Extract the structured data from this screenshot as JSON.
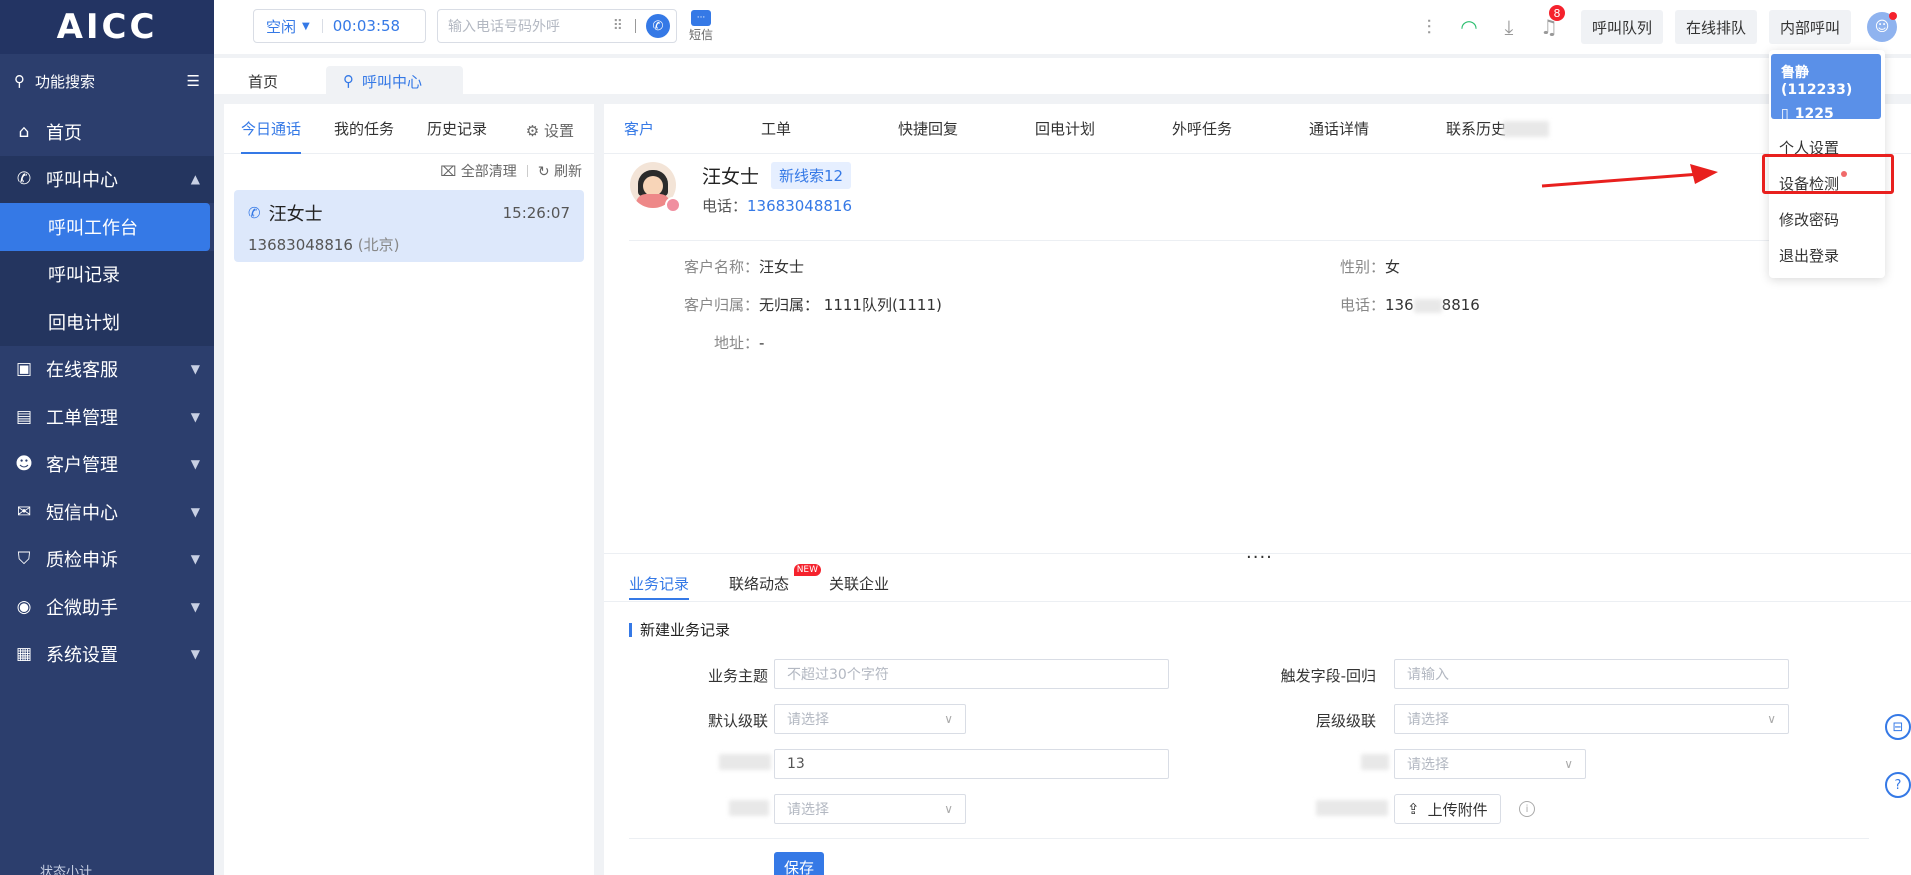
{
  "app": {
    "logo": "AICC"
  },
  "sidebar": {
    "search_label": "功能搜索",
    "items": [
      {
        "label": "首页",
        "icon": "home-icon"
      },
      {
        "label": "呼叫中心",
        "icon": "phone-icon",
        "open": true,
        "children": [
          {
            "label": "呼叫工作台",
            "active": true
          },
          {
            "label": "呼叫记录"
          },
          {
            "label": "回电计划"
          }
        ]
      },
      {
        "label": "在线客服",
        "icon": "chat-icon"
      },
      {
        "label": "工单管理",
        "icon": "clipboard-icon"
      },
      {
        "label": "客户管理",
        "icon": "users-icon"
      },
      {
        "label": "短信中心",
        "icon": "mail-icon"
      },
      {
        "label": "质检申诉",
        "icon": "shield-icon"
      },
      {
        "label": "企微助手",
        "icon": "wechat-icon"
      },
      {
        "label": "系统设置",
        "icon": "grid-icon"
      }
    ],
    "bottom_label": "状态小计"
  },
  "topbar": {
    "status": "空闲",
    "timer": "00:03:58",
    "dial_placeholder": "输入电话号码外呼",
    "sms_label": "短信",
    "notification_count": "8",
    "buttons": [
      "呼叫队列",
      "在线排队",
      "内部呼叫"
    ]
  },
  "page_tabs": [
    {
      "label": "首页"
    },
    {
      "label": "呼叫中心",
      "active": true
    }
  ],
  "call_panel": {
    "tabs": [
      "今日通话",
      "我的任务",
      "历史记录"
    ],
    "settings_label": "设置",
    "clear_all_label": "全部清理",
    "refresh_label": "刷新",
    "calls": [
      {
        "name": "汪女士",
        "time": "15:26:07",
        "number": "13683048816",
        "location": "(北京)"
      }
    ]
  },
  "main": {
    "tabs": [
      "客户",
      "工单",
      "快捷回复",
      "回电计划",
      "外呼任务",
      "通话详情",
      "联系历史"
    ],
    "customer": {
      "name": "汪女士",
      "tag": "新线索12",
      "phone_label": "电话：",
      "phone": "13683048816",
      "fields": {
        "name_label": "客户名称：",
        "name_value": "汪女士",
        "gender_label": "性别：",
        "gender_value": "女",
        "owner_label": "客户归属：",
        "owner_value": "无归属： 1111队列(1111)",
        "phone_label": "电话：",
        "phone_prefix": "136",
        "phone_suffix": "8816",
        "address_label": "地址：",
        "address_value": "-"
      }
    },
    "bottom_tabs": [
      "业务记录",
      "联络动态",
      "关联企业"
    ],
    "new_badge": "NEW",
    "section_title": "新建业务记录",
    "form": {
      "subject_label": "业务主题",
      "subject_placeholder": "不超过30个字符",
      "trigger_label": "触发字段-回归",
      "trigger_placeholder": "请输入",
      "default_cascade_label": "默认级联",
      "default_cascade_placeholder": "请选择",
      "level_cascade_label": "层级级联",
      "level_cascade_placeholder": "请选择",
      "number_value": "13",
      "select_placeholder": "请选择",
      "upload_label": "上传附件",
      "save_label": "保存"
    }
  },
  "user_menu": {
    "user": "鲁静 (112233)",
    "extension": "1225",
    "items": [
      "个人设置",
      "设备检测",
      "修改密码",
      "退出登录"
    ]
  },
  "colors": {
    "sidebar": "#2c3e6d",
    "accent": "#3579e6",
    "highlight": "#e8201e"
  }
}
